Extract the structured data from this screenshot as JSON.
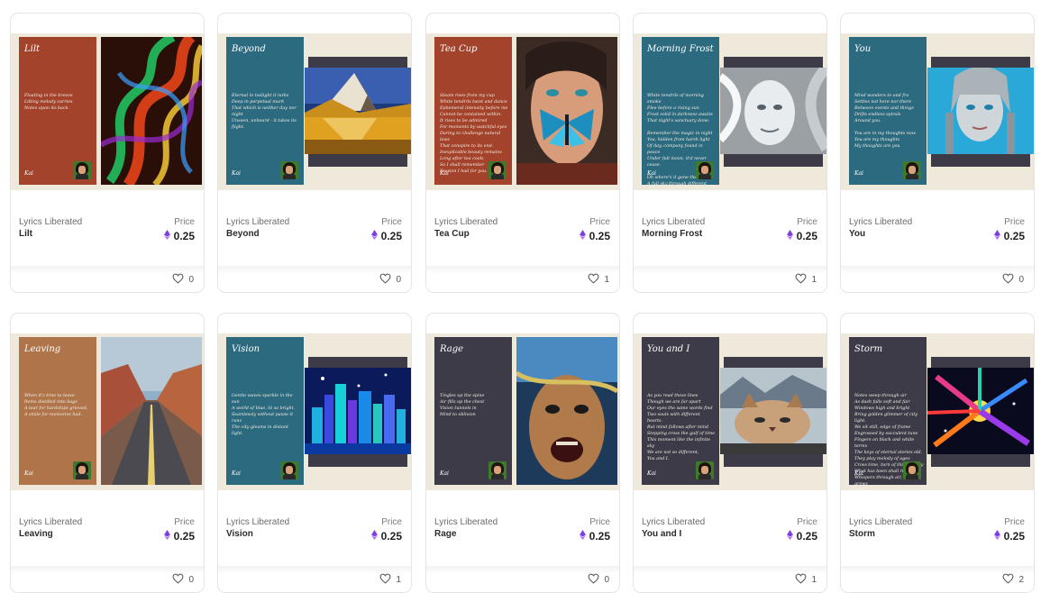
{
  "colors": {
    "accent_eth": "#7b3fe4",
    "card_border": "#e4e4e4",
    "page_bg": "#ffffff"
  },
  "labels": {
    "price_label": "Price",
    "currency_icon": "ethereum-icon",
    "like_icon": "heart-icon"
  },
  "cards": [
    {
      "collection": "Lyrics Liberated",
      "name": "Lilt",
      "price": "0.25",
      "likes": "0",
      "art": {
        "title": "Lilt",
        "signature": "Kai",
        "panel_color": "#a3432c",
        "layout": "tall",
        "lyrics": "Floating in the breeze\nLilting melody carries\nNotes upon its back."
      }
    },
    {
      "collection": "Lyrics Liberated",
      "name": "Beyond",
      "price": "0.25",
      "likes": "0",
      "art": {
        "title": "Beyond",
        "signature": "Kai",
        "panel_color": "#2c6a80",
        "layout": "wide",
        "lyrics": "Eternal in twilight it lurks\nDeep in perpetual murk\nThat which is neither day nor night\nUnseen, unheard - it takes its flight."
      }
    },
    {
      "collection": "Lyrics Liberated",
      "name": "Tea Cup",
      "price": "0.25",
      "likes": "1",
      "art": {
        "title": "Tea Cup",
        "signature": "Kai",
        "panel_color": "#a3432c",
        "layout": "tall",
        "lyrics": "Steam rises from my cup\nWhite tendrils twist and dance\nEphemeral intensity before me\nCannot be contained within.\nIt rises to be admired\nFor moments by watchful eyes\nDaring to challenge natural laws\nThat conspire to its end.\nInexplicable beauty remains\nLong after tea cools\nSo I shall remember\nPassion I had for you."
      }
    },
    {
      "collection": "Lyrics Liberated",
      "name": "Morning Frost",
      "price": "0.25",
      "likes": "1",
      "art": {
        "title": "Morning Frost",
        "signature": "Kai",
        "panel_color": "#2c6a80",
        "layout": "wide",
        "lyrics": "White tendrils of morning smoke\nFlee before a rising sun\nFrost solid in darkness awaits\nThat night's sanctuary done.\n\nRemember the magic in night\nYou, hidden from harsh light\nOf day, company found in peace\nUnder full moon, it'd never cease.\n\nOh where's it gone the moon\nA full sky through different tune\nBlack melting, streaks on a wall\nWhite rising, wafting out the hall."
      }
    },
    {
      "collection": "Lyrics Liberated",
      "name": "You",
      "price": "0.25",
      "likes": "0",
      "art": {
        "title": "You",
        "signature": "Kai",
        "panel_color": "#2c6a80",
        "layout": "wide",
        "lyrics": "Mind wanders to and fro\nSettles not here nor there\nBetween events and things\nDrifts endless spirals\nAround you.\n\nYou are in my thoughts now\nYou are my thoughts\nMy thoughts are you"
      }
    },
    {
      "collection": "Lyrics Liberated",
      "name": "Leaving",
      "price": "0.25",
      "likes": "0",
      "art": {
        "title": "Leaving",
        "signature": "Kai",
        "panel_color": "#b0744a",
        "layout": "tall",
        "lyrics": "When it's time to leave\nItems distilled into bags\nA tear for hardships grieved,\nA smile for memories had."
      }
    },
    {
      "collection": "Lyrics Liberated",
      "name": "Vision",
      "price": "0.25",
      "likes": "1",
      "art": {
        "title": "Vision",
        "signature": "Kai",
        "panel_color": "#2c6a80",
        "layout": "wide",
        "lyrics": "Gentle waves sparkle in the sun\nA world of blue, lit so bright.\nSeamlessly without pause it runs\nThe city gleams in distant light."
      }
    },
    {
      "collection": "Lyrics Liberated",
      "name": "Rage",
      "price": "0.25",
      "likes": "0",
      "art": {
        "title": "Rage",
        "signature": "Kai",
        "panel_color": "#3d3b48",
        "layout": "tall",
        "lyrics": "Tingles up the spine\nAir fills up the chest\nVision tunnels in\nMind to oblivion"
      }
    },
    {
      "collection": "Lyrics Liberated",
      "name": "You and I",
      "price": "0.25",
      "likes": "1",
      "art": {
        "title": "You and I",
        "signature": "Kai",
        "panel_color": "#3d3b48",
        "layout": "wide",
        "lyrics": "As you read these lines\nThough we are far apart\nOur eyes the same words find\nTwo souls with different hearts.\nBut mind follows after mind\nStepping cross the gulf of time\nThis moment like the infinite sky\nWe are not so different,\nYou and I."
      }
    },
    {
      "collection": "Lyrics Liberated",
      "name": "Storm",
      "price": "0.25",
      "likes": "2",
      "art": {
        "title": "Storm",
        "signature": "Kai",
        "panel_color": "#3d3b48",
        "layout": "wide",
        "lyrics": "Notes weep through air\nAs dash falls soft and fair\nWindows high and bright\nBring golden glimmer of city light.\nWe sit still, edge of frame\nEngrossed by succulent tune\nFingers on black and white terms\nThe keys of eternal stories old.\nThey play melody of ages\nCross time, turn of this century\nWhat has been shall rise anew\nWhispers through air, chaos grows\nlouder\nAbove still and silent trees of town\nAsh walking while they patiently wait\nDroplets from the inbound storm."
      }
    }
  ]
}
